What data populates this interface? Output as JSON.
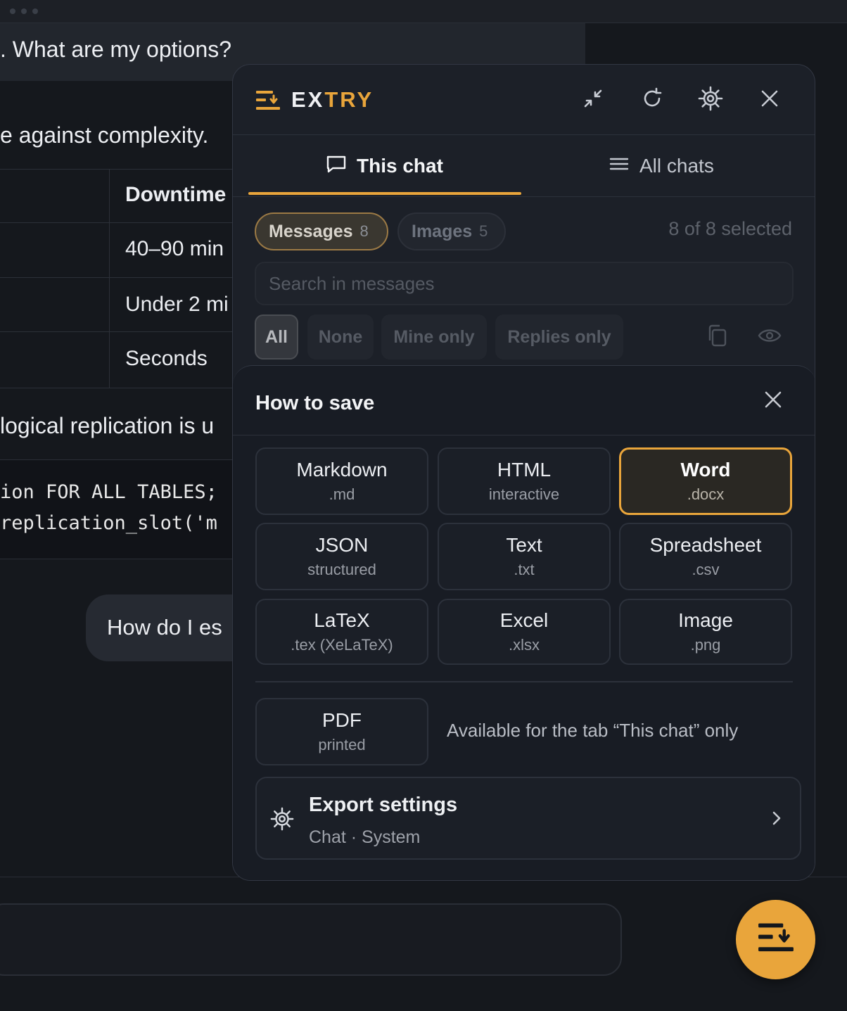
{
  "background": {
    "msg_top": ". What are my options?",
    "msg_tradeoff": "e against complexity.",
    "table": {
      "header": "Downtime",
      "rows": [
        "40–90 min",
        "Under 2 mi",
        "Seconds"
      ]
    },
    "msg_logical": " logical replication is u",
    "code_lines": [
      "ion FOR ALL TABLES;",
      "replication_slot('m"
    ],
    "user_bubble": "How do I es"
  },
  "panel": {
    "brand": {
      "part1": "EX",
      "part2": "TRY"
    },
    "header_icons": [
      "minimize-icon",
      "refresh-icon",
      "settings-gear-icon",
      "close-icon"
    ],
    "tabs": [
      {
        "label": "This chat",
        "icon": "chat-bubble-icon",
        "active": true
      },
      {
        "label": "All chats",
        "icon": "list-icon",
        "active": false
      }
    ],
    "chips": [
      {
        "label": "Messages",
        "count": "8",
        "active": true
      },
      {
        "label": "Images",
        "count": "5",
        "active": false
      }
    ],
    "selection_count": "8 of 8 selected",
    "search": {
      "placeholder": "Search in messages"
    },
    "filters": [
      {
        "label": "All",
        "active": true
      },
      {
        "label": "None",
        "active": false
      },
      {
        "label": "Mine only",
        "active": false
      },
      {
        "label": "Replies only",
        "active": false
      }
    ]
  },
  "save_sheet": {
    "title": "How to save",
    "formats": [
      {
        "name": "Markdown",
        "ext": ".md",
        "selected": false
      },
      {
        "name": "HTML",
        "ext": "interactive",
        "selected": false
      },
      {
        "name": "Word",
        "ext": ".docx",
        "selected": true
      },
      {
        "name": "JSON",
        "ext": "structured",
        "selected": false
      },
      {
        "name": "Text",
        "ext": ".txt",
        "selected": false
      },
      {
        "name": "Spreadsheet",
        "ext": ".csv",
        "selected": false
      },
      {
        "name": "LaTeX",
        "ext": ".tex (XeLaTeX)",
        "selected": false
      },
      {
        "name": "Excel",
        "ext": ".xlsx",
        "selected": false
      },
      {
        "name": "Image",
        "ext": ".png",
        "selected": false
      }
    ],
    "pdf": {
      "name": "PDF",
      "ext": "printed",
      "note": "Available for the tab “This chat” only"
    },
    "export_settings": {
      "title": "Export settings",
      "subtitle": "Chat · System"
    }
  },
  "colors": {
    "accent": "#e9a53b",
    "panel_bg": "#1c2028",
    "sheet_bg": "#181c24",
    "page_bg": "#15181d"
  }
}
